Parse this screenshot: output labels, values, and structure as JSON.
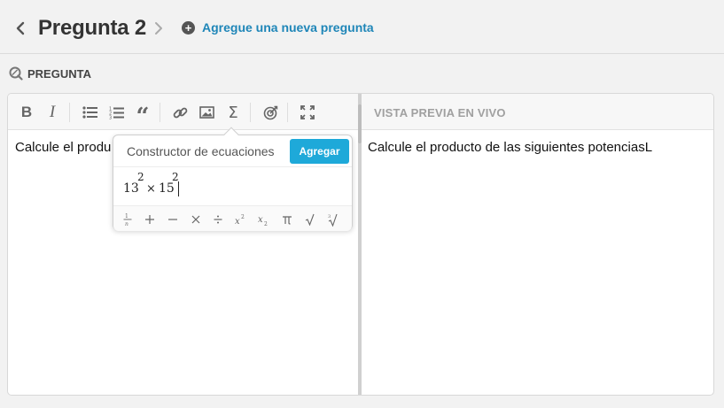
{
  "header": {
    "title": "Pregunta 2",
    "add_question_label": "Agregue una nueva pregunta"
  },
  "section": {
    "label": "PREGUNTA"
  },
  "editor": {
    "text": "Calcule el produ"
  },
  "preview": {
    "label": "VISTA PREVIA EN VIVO",
    "text": "Calcule el producto de las siguientes potenciasL"
  },
  "equation_builder": {
    "title": "Constructor de ecuaciones",
    "add_label": "Agregar",
    "input": {
      "base1": "13",
      "exp1": "2",
      "operator": "×",
      "base2": "15",
      "exp2": "2"
    },
    "symbols": [
      "fraction",
      "+",
      "−",
      "×",
      "÷",
      "x²",
      "x₂",
      "π",
      "√",
      "∛"
    ]
  },
  "colors": {
    "accent": "#1ea9d9",
    "link": "#1f86b8",
    "background": "#f2f2f2"
  }
}
